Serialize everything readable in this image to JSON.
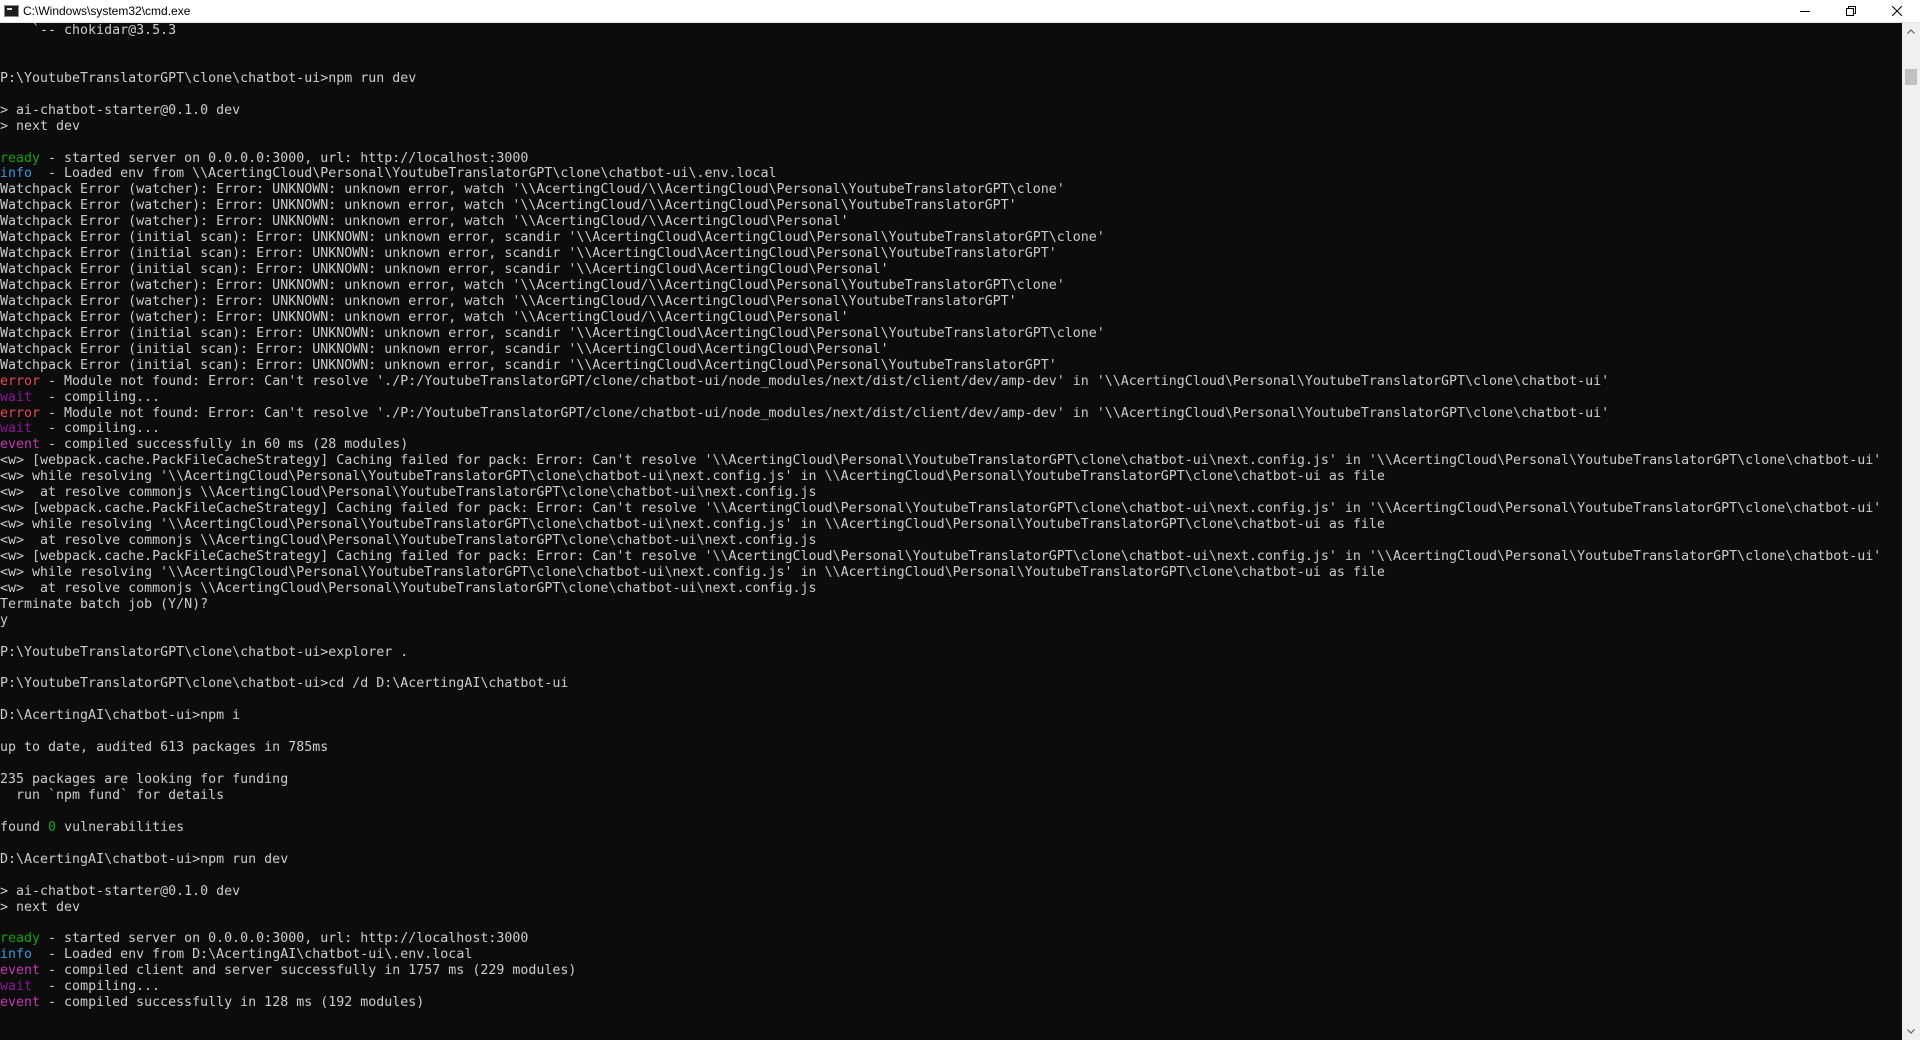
{
  "window": {
    "title": "C:\\Windows\\system32\\cmd.exe",
    "icon": "cmd-icon"
  },
  "controls": {
    "minimize": "minimize-icon",
    "maximize": "restore-icon",
    "close": "close-icon"
  },
  "colors": {
    "background": "#0c0c0c",
    "text": "#cccccc",
    "ready": "#13a10e",
    "info": "#3a96dd",
    "error": "#e74856",
    "wait": "#881798",
    "event": "#c239b3"
  },
  "console": {
    "lines": [
      [
        {
          "text": "    `-- chokidar@3.5.3"
        }
      ],
      [
        {
          "text": ""
        }
      ],
      [
        {
          "text": ""
        }
      ],
      [
        {
          "text": "P:\\YoutubeTranslatorGPT\\clone\\chatbot-ui>npm run dev"
        }
      ],
      [
        {
          "text": ""
        }
      ],
      [
        {
          "text": "> ai-chatbot-starter@0.1.0 dev"
        }
      ],
      [
        {
          "text": "> next dev"
        }
      ],
      [
        {
          "text": ""
        }
      ],
      [
        {
          "text": "ready",
          "c": "ready"
        },
        {
          "text": " - started server on 0.0.0.0:3000, url: http://localhost:3000"
        }
      ],
      [
        {
          "text": "info",
          "c": "info"
        },
        {
          "text": "  - Loaded env from \\\\AcertingCloud\\Personal\\YoutubeTranslatorGPT\\clone\\chatbot-ui\\.env.local"
        }
      ],
      [
        {
          "text": "Watchpack Error (watcher): Error: UNKNOWN: unknown error, watch '\\\\AcertingCloud/\\\\AcertingCloud\\Personal\\YoutubeTranslatorGPT\\clone'"
        }
      ],
      [
        {
          "text": "Watchpack Error (watcher): Error: UNKNOWN: unknown error, watch '\\\\AcertingCloud/\\\\AcertingCloud\\Personal\\YoutubeTranslatorGPT'"
        }
      ],
      [
        {
          "text": "Watchpack Error (watcher): Error: UNKNOWN: unknown error, watch '\\\\AcertingCloud/\\\\AcertingCloud\\Personal'"
        }
      ],
      [
        {
          "text": "Watchpack Error (initial scan): Error: UNKNOWN: unknown error, scandir '\\\\AcertingCloud\\AcertingCloud\\Personal\\YoutubeTranslatorGPT\\clone'"
        }
      ],
      [
        {
          "text": "Watchpack Error (initial scan): Error: UNKNOWN: unknown error, scandir '\\\\AcertingCloud\\AcertingCloud\\Personal\\YoutubeTranslatorGPT'"
        }
      ],
      [
        {
          "text": "Watchpack Error (initial scan): Error: UNKNOWN: unknown error, scandir '\\\\AcertingCloud\\AcertingCloud\\Personal'"
        }
      ],
      [
        {
          "text": "Watchpack Error (watcher): Error: UNKNOWN: unknown error, watch '\\\\AcertingCloud/\\\\AcertingCloud\\Personal\\YoutubeTranslatorGPT\\clone'"
        }
      ],
      [
        {
          "text": "Watchpack Error (watcher): Error: UNKNOWN: unknown error, watch '\\\\AcertingCloud/\\\\AcertingCloud\\Personal\\YoutubeTranslatorGPT'"
        }
      ],
      [
        {
          "text": "Watchpack Error (watcher): Error: UNKNOWN: unknown error, watch '\\\\AcertingCloud/\\\\AcertingCloud\\Personal'"
        }
      ],
      [
        {
          "text": "Watchpack Error (initial scan): Error: UNKNOWN: unknown error, scandir '\\\\AcertingCloud\\AcertingCloud\\Personal\\YoutubeTranslatorGPT\\clone'"
        }
      ],
      [
        {
          "text": "Watchpack Error (initial scan): Error: UNKNOWN: unknown error, scandir '\\\\AcertingCloud\\AcertingCloud\\Personal'"
        }
      ],
      [
        {
          "text": "Watchpack Error (initial scan): Error: UNKNOWN: unknown error, scandir '\\\\AcertingCloud\\AcertingCloud\\Personal\\YoutubeTranslatorGPT'"
        }
      ],
      [
        {
          "text": "error",
          "c": "error"
        },
        {
          "text": " - Module not found: Error: Can't resolve './P:/YoutubeTranslatorGPT/clone/chatbot-ui/node_modules/next/dist/client/dev/amp-dev' in '\\\\AcertingCloud\\Personal\\YoutubeTranslatorGPT\\clone\\chatbot-ui'"
        }
      ],
      [
        {
          "text": "wait",
          "c": "wait"
        },
        {
          "text": "  - compiling..."
        }
      ],
      [
        {
          "text": "error",
          "c": "error"
        },
        {
          "text": " - Module not found: Error: Can't resolve './P:/YoutubeTranslatorGPT/clone/chatbot-ui/node_modules/next/dist/client/dev/amp-dev' in '\\\\AcertingCloud\\Personal\\YoutubeTranslatorGPT\\clone\\chatbot-ui'"
        }
      ],
      [
        {
          "text": "wait",
          "c": "wait"
        },
        {
          "text": "  - compiling..."
        }
      ],
      [
        {
          "text": "event",
          "c": "event"
        },
        {
          "text": " - compiled successfully in 60 ms (28 modules)"
        }
      ],
      [
        {
          "text": "<w> [webpack.cache.PackFileCacheStrategy] Caching failed for pack: Error: Can't resolve '\\\\AcertingCloud\\Personal\\YoutubeTranslatorGPT\\clone\\chatbot-ui\\next.config.js' in '\\\\AcertingCloud\\Personal\\YoutubeTranslatorGPT\\clone\\chatbot-ui'"
        }
      ],
      [
        {
          "text": "<w> while resolving '\\\\AcertingCloud\\Personal\\YoutubeTranslatorGPT\\clone\\chatbot-ui\\next.config.js' in \\\\AcertingCloud\\Personal\\YoutubeTranslatorGPT\\clone\\chatbot-ui as file"
        }
      ],
      [
        {
          "text": "<w>  at resolve commonjs \\\\AcertingCloud\\Personal\\YoutubeTranslatorGPT\\clone\\chatbot-ui\\next.config.js"
        }
      ],
      [
        {
          "text": "<w> [webpack.cache.PackFileCacheStrategy] Caching failed for pack: Error: Can't resolve '\\\\AcertingCloud\\Personal\\YoutubeTranslatorGPT\\clone\\chatbot-ui\\next.config.js' in '\\\\AcertingCloud\\Personal\\YoutubeTranslatorGPT\\clone\\chatbot-ui'"
        }
      ],
      [
        {
          "text": "<w> while resolving '\\\\AcertingCloud\\Personal\\YoutubeTranslatorGPT\\clone\\chatbot-ui\\next.config.js' in \\\\AcertingCloud\\Personal\\YoutubeTranslatorGPT\\clone\\chatbot-ui as file"
        }
      ],
      [
        {
          "text": "<w>  at resolve commonjs \\\\AcertingCloud\\Personal\\YoutubeTranslatorGPT\\clone\\chatbot-ui\\next.config.js"
        }
      ],
      [
        {
          "text": "<w> [webpack.cache.PackFileCacheStrategy] Caching failed for pack: Error: Can't resolve '\\\\AcertingCloud\\Personal\\YoutubeTranslatorGPT\\clone\\chatbot-ui\\next.config.js' in '\\\\AcertingCloud\\Personal\\YoutubeTranslatorGPT\\clone\\chatbot-ui'"
        }
      ],
      [
        {
          "text": "<w> while resolving '\\\\AcertingCloud\\Personal\\YoutubeTranslatorGPT\\clone\\chatbot-ui\\next.config.js' in \\\\AcertingCloud\\Personal\\YoutubeTranslatorGPT\\clone\\chatbot-ui as file"
        }
      ],
      [
        {
          "text": "<w>  at resolve commonjs \\\\AcertingCloud\\Personal\\YoutubeTranslatorGPT\\clone\\chatbot-ui\\next.config.js"
        }
      ],
      [
        {
          "text": "Terminate batch job (Y/N)?"
        }
      ],
      [
        {
          "text": "y"
        }
      ],
      [
        {
          "text": ""
        }
      ],
      [
        {
          "text": "P:\\YoutubeTranslatorGPT\\clone\\chatbot-ui>explorer ."
        }
      ],
      [
        {
          "text": ""
        }
      ],
      [
        {
          "text": "P:\\YoutubeTranslatorGPT\\clone\\chatbot-ui>cd /d D:\\AcertingAI\\chatbot-ui"
        }
      ],
      [
        {
          "text": ""
        }
      ],
      [
        {
          "text": "D:\\AcertingAI\\chatbot-ui>npm i"
        }
      ],
      [
        {
          "text": ""
        }
      ],
      [
        {
          "text": "up to date, audited 613 packages in 785ms"
        }
      ],
      [
        {
          "text": ""
        }
      ],
      [
        {
          "text": "235 packages are looking for funding"
        }
      ],
      [
        {
          "text": "  run `npm fund` for details"
        }
      ],
      [
        {
          "text": ""
        }
      ],
      [
        {
          "text": "found "
        },
        {
          "text": "0",
          "c": "green"
        },
        {
          "text": " vulnerabilities"
        }
      ],
      [
        {
          "text": ""
        }
      ],
      [
        {
          "text": "D:\\AcertingAI\\chatbot-ui>npm run dev"
        }
      ],
      [
        {
          "text": ""
        }
      ],
      [
        {
          "text": "> ai-chatbot-starter@0.1.0 dev"
        }
      ],
      [
        {
          "text": "> next dev"
        }
      ],
      [
        {
          "text": ""
        }
      ],
      [
        {
          "text": "ready",
          "c": "ready"
        },
        {
          "text": " - started server on 0.0.0.0:3000, url: http://localhost:3000"
        }
      ],
      [
        {
          "text": "info",
          "c": "info"
        },
        {
          "text": "  - Loaded env from D:\\AcertingAI\\chatbot-ui\\.env.local"
        }
      ],
      [
        {
          "text": "event",
          "c": "event"
        },
        {
          "text": " - compiled client and server successfully in 1757 ms (229 modules)"
        }
      ],
      [
        {
          "text": "wait",
          "c": "wait"
        },
        {
          "text": "  - compiling..."
        }
      ],
      [
        {
          "text": "event",
          "c": "event"
        },
        {
          "text": " - compiled successfully in 128 ms (192 modules)"
        }
      ]
    ]
  },
  "scrollbar": {
    "up_arrow": "scroll-up-arrow-icon",
    "down_arrow": "scroll-down-arrow-icon",
    "position_fraction": 0.03
  }
}
